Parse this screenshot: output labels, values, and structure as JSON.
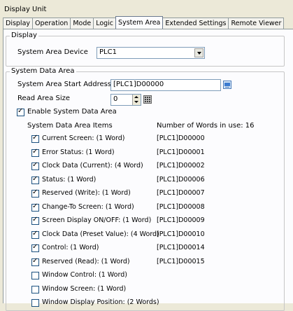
{
  "window": {
    "title": "Display Unit"
  },
  "tabs": [
    "Display",
    "Operation",
    "Mode",
    "Logic",
    "System Area",
    "Extended Settings",
    "Remote Viewer"
  ],
  "active_tab": "System Area",
  "display_group": {
    "legend": "Display",
    "system_area_device_label": "System Area Device",
    "system_area_device_value": "PLC1"
  },
  "system_data_group": {
    "legend": "System Data Area",
    "start_address_label": "System Area Start Address",
    "start_address_value": "[PLC1]D00000",
    "read_area_size_label": "Read Area Size",
    "read_area_size_value": "0",
    "enable_label": "Enable System Data Area",
    "enable_checked": true,
    "items_header": "System Data Area Items",
    "words_in_use": "Number of Words in use: 16",
    "items": [
      {
        "label": "Current Screen: (1 Word)",
        "checked": true,
        "address": "[PLC1]D00000"
      },
      {
        "label": "Error Status: (1 Word)",
        "checked": true,
        "address": "[PLC1]D00001"
      },
      {
        "label": "Clock Data (Current): (4 Word)",
        "checked": true,
        "address": "[PLC1]D00002"
      },
      {
        "label": "Status: (1 Word)",
        "checked": true,
        "address": "[PLC1]D00006"
      },
      {
        "label": "Reserved (Write): (1 Word)",
        "checked": true,
        "address": "[PLC1]D00007"
      },
      {
        "label": "Change-To Screen: (1 Word)",
        "checked": true,
        "address": "[PLC1]D00008"
      },
      {
        "label": "Screen Display ON/OFF: (1 Word)",
        "checked": true,
        "address": "[PLC1]D00009"
      },
      {
        "label": "Clock Data (Preset Value): (4 Word)",
        "checked": true,
        "address": "[PLC1]D00010"
      },
      {
        "label": "Control: (1 Word)",
        "checked": true,
        "address": "[PLC1]D00014"
      },
      {
        "label": "Reserved (Read): (1 Word)",
        "checked": true,
        "address": "[PLC1]D00015"
      },
      {
        "label": "Window Control: (1 Word)",
        "checked": false,
        "address": ""
      },
      {
        "label": "Window Screen: (1 Word)",
        "checked": false,
        "address": ""
      },
      {
        "label": "Window Display Position: (2 Words)",
        "checked": false,
        "address": ""
      }
    ]
  }
}
